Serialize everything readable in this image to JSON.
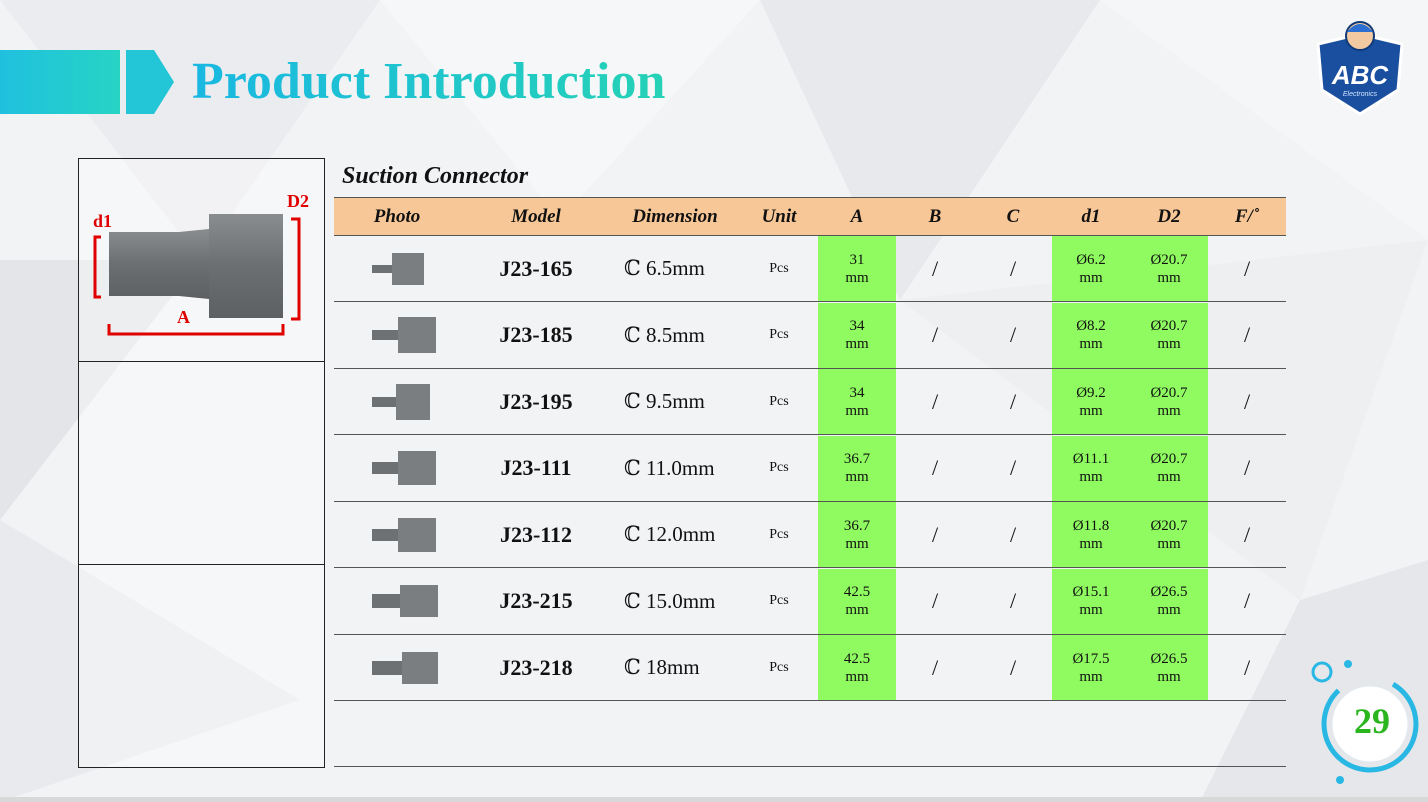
{
  "header": {
    "title": "Product Introduction"
  },
  "logo": {
    "brand": "ABC",
    "tagline": "Electronics"
  },
  "diagram": {
    "label_d1": "d1",
    "label_d2": "D2",
    "label_a": "A"
  },
  "table": {
    "subtitle": "Suction Connector",
    "columns": [
      "Photo",
      "Model",
      "Dimension",
      "Unit",
      "A",
      "B",
      "C",
      "d1",
      "D2",
      "F/˚"
    ],
    "rows": [
      {
        "model": "J23-165",
        "dimension": "ℂ 6.5mm",
        "unit": "Pcs",
        "a_val": "31",
        "a_unit": "mm",
        "b": "/",
        "c": "/",
        "d1_val": "Ø6.2",
        "d1_unit": "mm",
        "d2_val": "Ø20.7",
        "d2_unit": "mm",
        "f": "/"
      },
      {
        "model": "J23-185",
        "dimension": "ℂ 8.5mm",
        "unit": "Pcs",
        "a_val": "34",
        "a_unit": "mm",
        "b": "/",
        "c": "/",
        "d1_val": "Ø8.2",
        "d1_unit": "mm",
        "d2_val": "Ø20.7",
        "d2_unit": "mm",
        "f": "/"
      },
      {
        "model": "J23-195",
        "dimension": "ℂ 9.5mm",
        "unit": "Pcs",
        "a_val": "34",
        "a_unit": "mm",
        "b": "/",
        "c": "/",
        "d1_val": "Ø9.2",
        "d1_unit": "mm",
        "d2_val": "Ø20.7",
        "d2_unit": "mm",
        "f": "/"
      },
      {
        "model": "J23-111",
        "dimension": "ℂ 11.0mm",
        "unit": "Pcs",
        "a_val": "36.7",
        "a_unit": "mm",
        "b": "/",
        "c": "/",
        "d1_val": "Ø11.1",
        "d1_unit": "mm",
        "d2_val": "Ø20.7",
        "d2_unit": "mm",
        "f": "/"
      },
      {
        "model": "J23-112",
        "dimension": "ℂ 12.0mm",
        "unit": "Pcs",
        "a_val": "36.7",
        "a_unit": "mm",
        "b": "/",
        "c": "/",
        "d1_val": "Ø11.8",
        "d1_unit": "mm",
        "d2_val": "Ø20.7",
        "d2_unit": "mm",
        "f": "/"
      },
      {
        "model": "J23-215",
        "dimension": "ℂ 15.0mm",
        "unit": "Pcs",
        "a_val": "42.5",
        "a_unit": "mm",
        "b": "/",
        "c": "/",
        "d1_val": "Ø15.1",
        "d1_unit": "mm",
        "d2_val": "Ø26.5",
        "d2_unit": "mm",
        "f": "/"
      },
      {
        "model": "J23-218",
        "dimension": "ℂ 18mm",
        "unit": "Pcs",
        "a_val": "42.5",
        "a_unit": "mm",
        "b": "/",
        "c": "/",
        "d1_val": "Ø17.5",
        "d1_unit": "mm",
        "d2_val": "Ø26.5",
        "d2_unit": "mm",
        "f": "/"
      }
    ]
  },
  "page": {
    "number": "29"
  },
  "colors": {
    "title_gradient_start": "#19b8e2",
    "title_gradient_end": "#25d2b6",
    "header_fill": "#f8c797",
    "highlight_green": "#8ffb60",
    "dimension_red": "#e00000",
    "page_number": "#2bb51f"
  }
}
